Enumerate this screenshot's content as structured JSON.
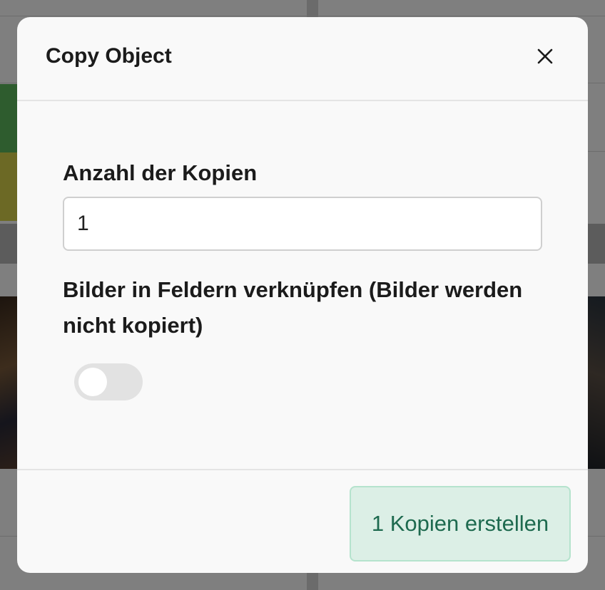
{
  "modal": {
    "title": "Copy Object",
    "close_icon": "close-icon",
    "copies_label": "Anzahl der Kopien",
    "copies_value": "1",
    "link_images_label": "Bilder in Feldern verknüpfen (Bilder werden nicht kopiert)",
    "link_images_enabled": false,
    "submit_label": "1 Kopien erstellen"
  },
  "colors": {
    "accent_bg": "#dcefe6",
    "accent_border": "#b5e3cd",
    "accent_text": "#1e6a4f"
  }
}
